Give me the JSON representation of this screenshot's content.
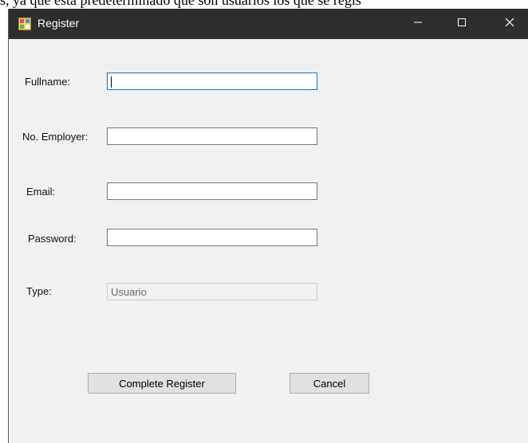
{
  "caption": {
    "text": "s, ya que está predeterminado que son usuarios los que se regis"
  },
  "window": {
    "title": "Register",
    "icon": "form-app-icon",
    "controls": {
      "minimize_icon": "minimize-icon",
      "maximize_icon": "maximize-icon",
      "close_icon": "close-icon"
    },
    "titlebar_color": "#2e2e2e",
    "background_color": "#f0f0f0"
  },
  "form": {
    "fullname": {
      "label": "Fullname:",
      "value": ""
    },
    "employer": {
      "label": "No. Employer:",
      "value": ""
    },
    "email": {
      "label": "Email:",
      "value": ""
    },
    "password": {
      "label": "Password:",
      "value": ""
    },
    "type": {
      "label": "Type:",
      "value": "Usuario"
    }
  },
  "buttons": {
    "complete_register": "Complete Register",
    "cancel": "Cancel"
  }
}
